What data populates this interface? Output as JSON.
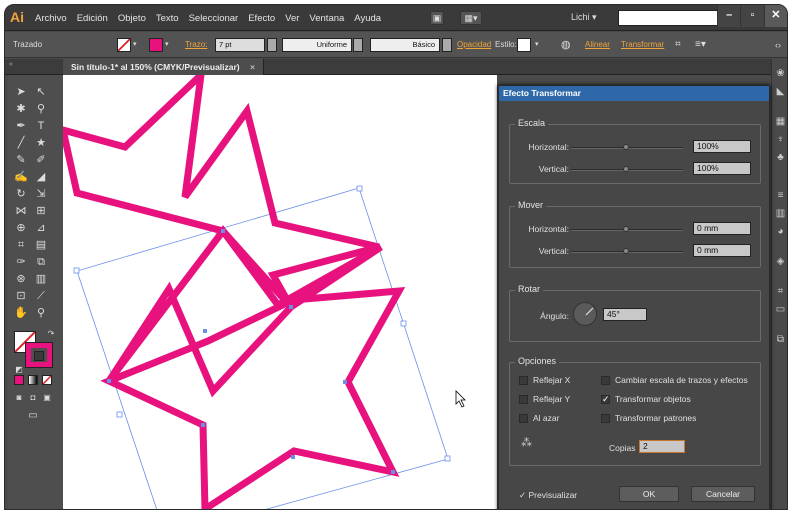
{
  "app": {
    "logo": "Ai",
    "user": "Lichi ▾"
  },
  "menus": [
    "Archivo",
    "Edición",
    "Objeto",
    "Texto",
    "Seleccionar",
    "Efecto",
    "Ver",
    "Ventana",
    "Ayuda"
  ],
  "window_controls": {
    "minimize": "–",
    "maximize": "▫",
    "close": "✕"
  },
  "control_bar": {
    "object_type": "Trazado",
    "trazo_label": "Trazo:",
    "stroke_weight": "7 pt",
    "profile_uniform": "Uniforme",
    "brush_basic": "Básico",
    "opacity_label": "Opacidad",
    "style_label": "Estilo:",
    "align_link": "Alinear",
    "transform_link": "Transformar"
  },
  "document_tab": {
    "title": "Sin título-1* al 150% (CMYK/Previsualizar)",
    "close": "×"
  },
  "dialog": {
    "title": "Efecto Transformar",
    "scale": {
      "group": "Escala",
      "h_label": "Horizontal:",
      "h_value": "100%",
      "v_label": "Vertical:",
      "v_value": "100%",
      "h_pos": 0.5,
      "v_pos": 0.5
    },
    "move": {
      "group": "Mover",
      "h_label": "Horizontal:",
      "h_value": "0 mm",
      "v_label": "Vertical:",
      "v_value": "0 mm",
      "h_pos": 0.5,
      "v_pos": 0.5
    },
    "rotate": {
      "group": "Rotar",
      "angle_label": "Ángulo:",
      "angle_value": "45°"
    },
    "options": {
      "group": "Opciones",
      "reflect_x": "Reflejar X",
      "reflect_y": "Reflejar Y",
      "random": "Al azar",
      "scale_strokes": "Cambiar escala de trazos y efectos",
      "transform_objects": "Transformar objetos",
      "transform_patterns": "Transformar patrones",
      "copies_label": "Copias",
      "copies_value": "2"
    },
    "preview_label": "Previsualizar",
    "ok_label": "OK",
    "cancel_label": "Cancelar"
  },
  "colors": {
    "stroke": "#e8127e",
    "selection": "#6a8fe8",
    "dialog_title": "#2f68a8",
    "accent_link": "#f0a53a"
  }
}
